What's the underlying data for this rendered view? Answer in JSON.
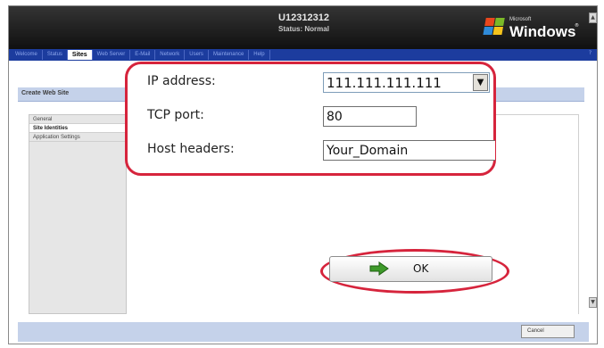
{
  "header": {
    "server_name": "U12312312",
    "status_text": "Status: Normal",
    "logo": {
      "small_text": "Microsoft",
      "word": "Windows",
      "trademark": "®"
    }
  },
  "nav": {
    "items": [
      {
        "label": "Welcome"
      },
      {
        "label": "Status"
      },
      {
        "label": "Sites",
        "active": true
      },
      {
        "label": "Web Server"
      },
      {
        "label": "E-Mail"
      },
      {
        "label": "Network"
      },
      {
        "label": "Users"
      },
      {
        "label": "Maintenance"
      },
      {
        "label": "Help"
      }
    ],
    "end_marker": "?"
  },
  "page": {
    "section_title": "Create Web Site",
    "side_tabs": [
      {
        "label": "General"
      },
      {
        "label": "Site Identities",
        "active": true
      },
      {
        "label": "Application Settings"
      }
    ]
  },
  "form": {
    "ip_label": "IP address:",
    "ip_value": "111.111.111.111",
    "port_label": "TCP port:",
    "port_value": "80",
    "host_label": "Host headers:",
    "host_value": "Your_Domain"
  },
  "buttons": {
    "ok_label": "OK",
    "cancel_label": "Cancel"
  },
  "icons": {
    "dropdown": "chevron-down-icon",
    "ok": "arrow-right-icon"
  },
  "colors": {
    "highlight": "#d6243c",
    "nav_background": "#1c3c9e",
    "section_bar": "#c5d2ea",
    "ok_arrow": "#3e9a2a"
  }
}
